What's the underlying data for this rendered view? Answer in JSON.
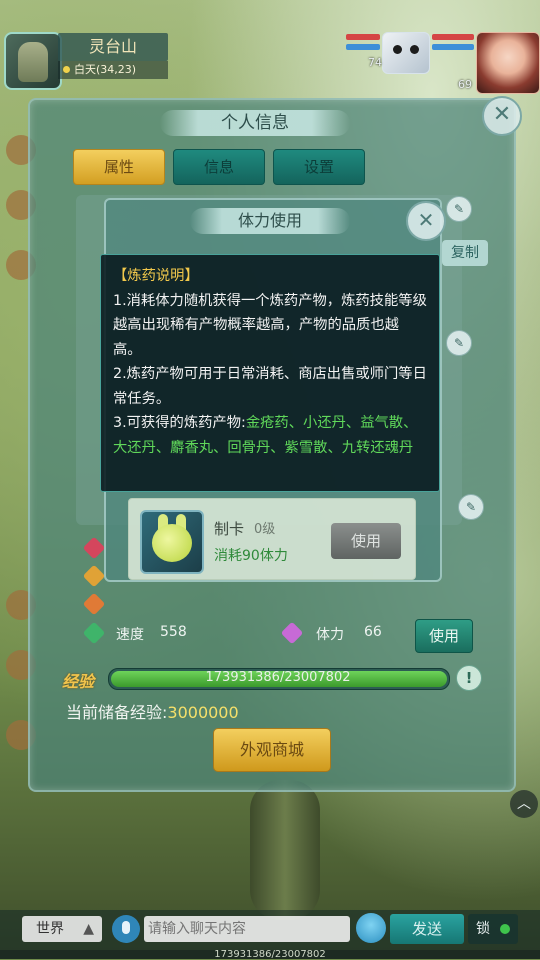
{
  "hud": {
    "map_name": "灵台山",
    "coords": "白天(34,23)",
    "pet_level": "74",
    "hero_level": "69"
  },
  "personal_info": {
    "title": "个人信息",
    "tabs": [
      "属性",
      "信息",
      "设置"
    ],
    "copy_label": "复制"
  },
  "stamina_popup": {
    "title": "体力使用",
    "item": {
      "name": "制卡",
      "level": "0级",
      "cost": "消耗90体力",
      "use_label": "使用"
    }
  },
  "alchemy_info": {
    "heading": "【炼药说明】",
    "p1": " 1.消耗体力随机获得一个炼药产物，炼药技能等级越高出现稀有产物概率越高，产物的品质也越高。",
    "p2": " 2.炼药产物可用于日常消耗、商店出售或师门等日常任务。",
    "p3_prefix": " 3.可获得的炼药产物:",
    "p3_items": "金疮药、小还丹、益气散、大还丹、麝香丸、回骨丹、紫雪散、九转还魂丹"
  },
  "stats": {
    "speed_label": "速度",
    "speed_value": "558",
    "stamina_label": "体力",
    "stamina_value": "66",
    "use_label": "使用"
  },
  "experience": {
    "label": "经验",
    "progress_text": "173931386/23007802",
    "fill_ratio": 1.0,
    "stored_label": "当前储备经验:",
    "stored_value": "3000000",
    "info_icon": "!"
  },
  "shop_button": "外观商城",
  "chat": {
    "channel": "世界",
    "placeholder": "请输入聊天内容",
    "send": "发送",
    "lock": "锁"
  },
  "colors": {
    "accent_gold": "#f3cf5e",
    "panel_teal": "#4c8478",
    "highlight_green": "#60d85a",
    "heading_yellow": "#f2c94c"
  }
}
